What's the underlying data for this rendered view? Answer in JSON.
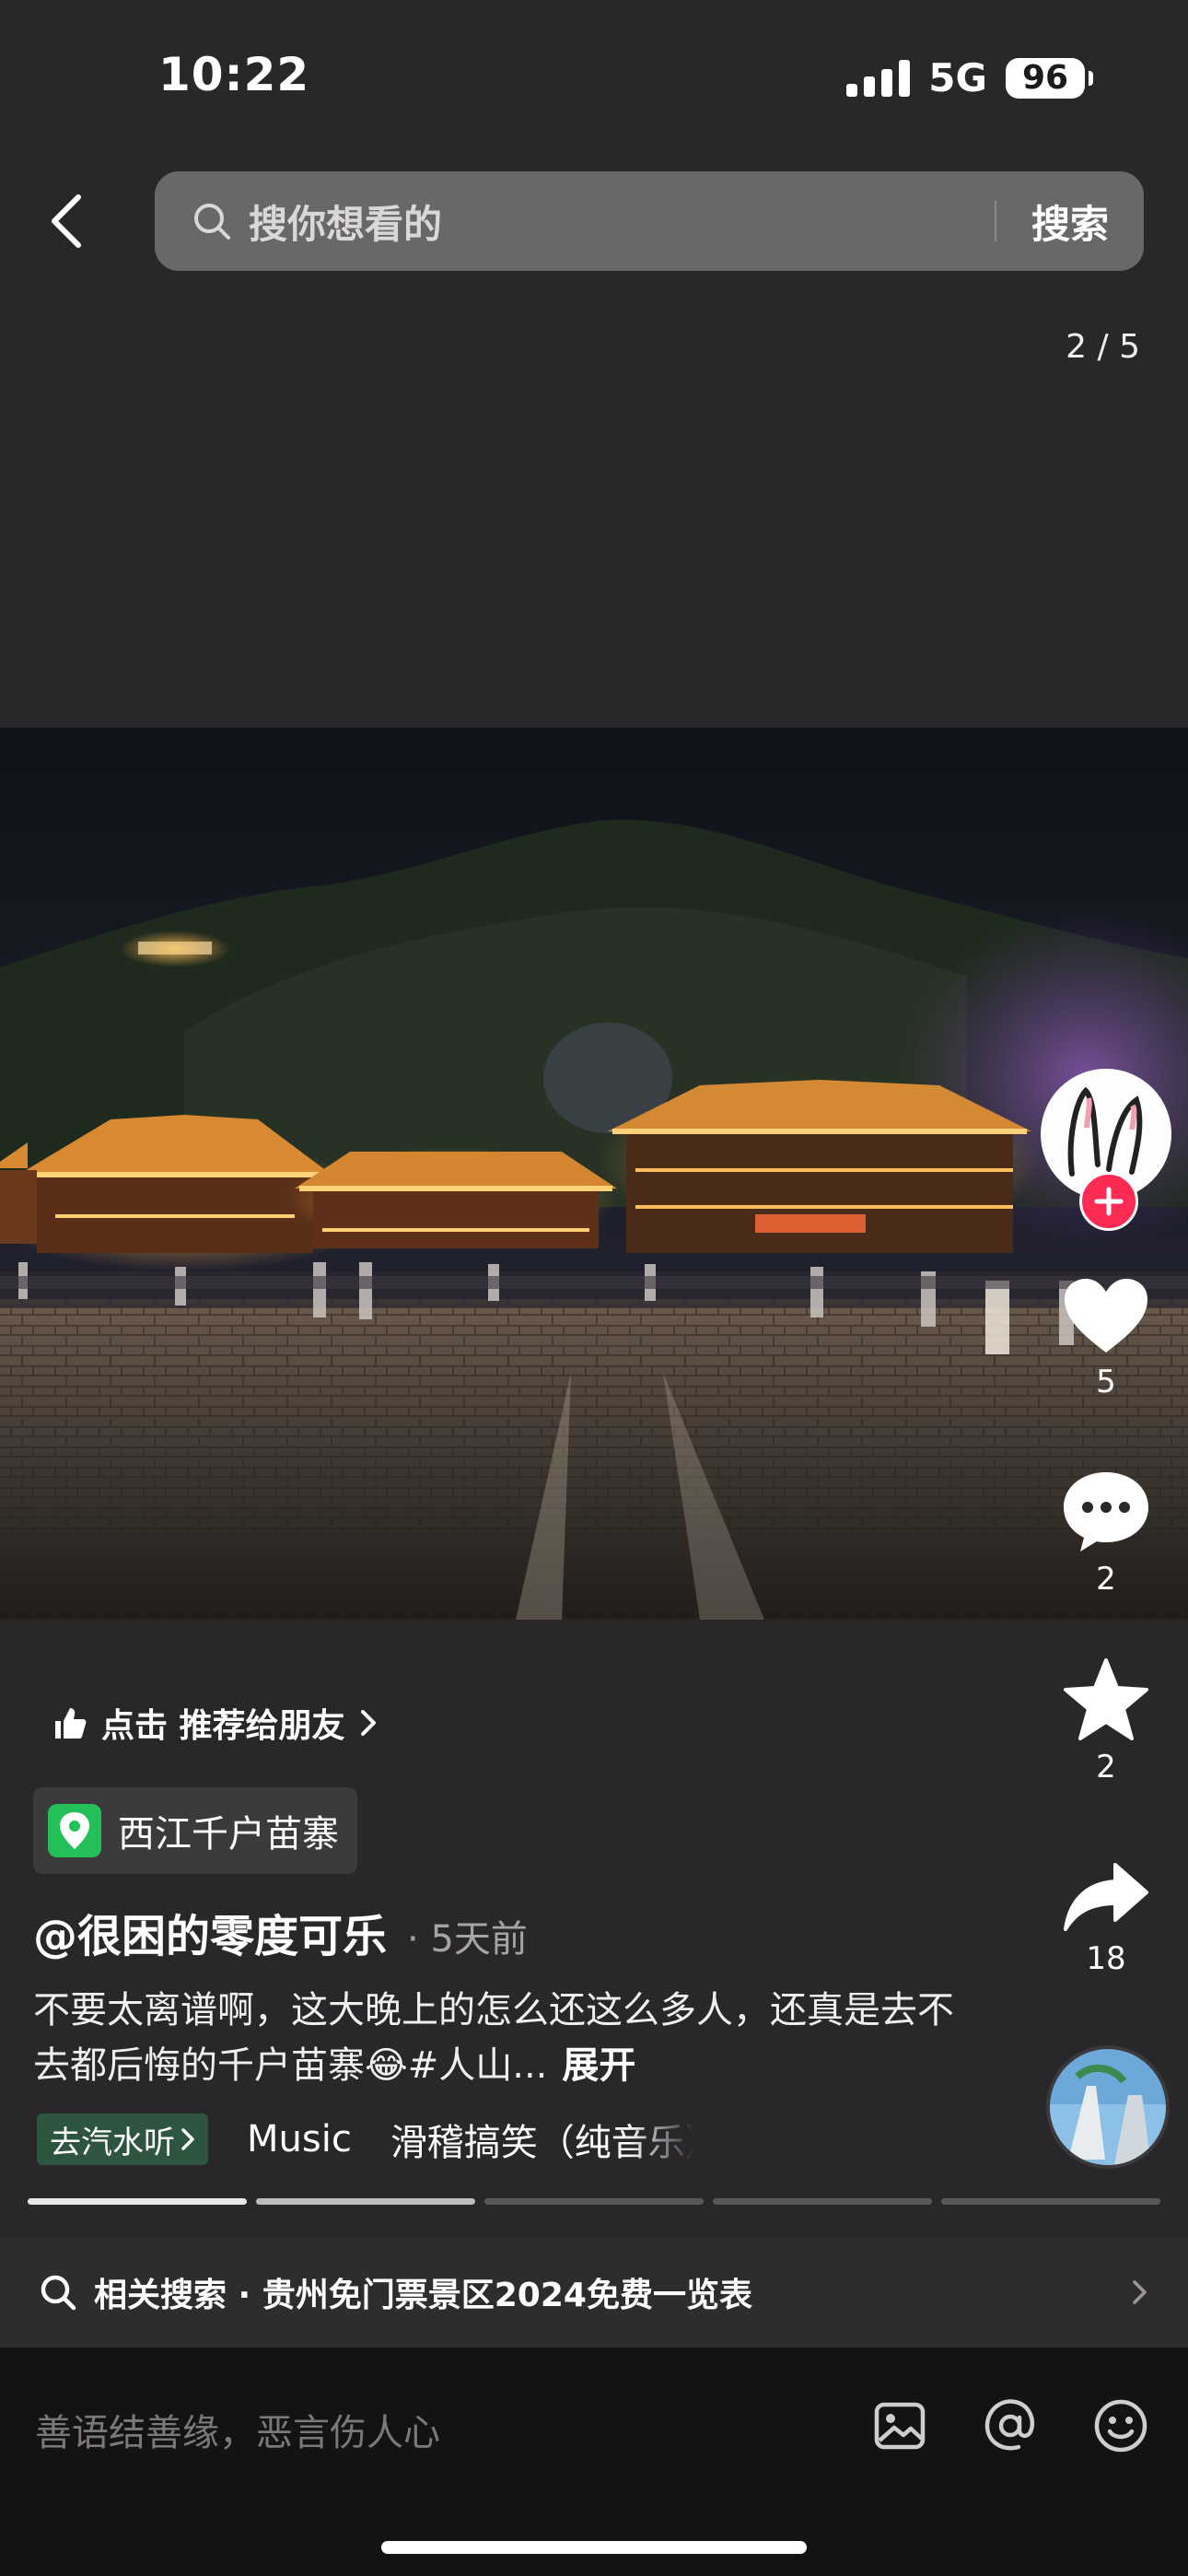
{
  "status_bar": {
    "time": "10:22",
    "network": "5G",
    "battery": "96"
  },
  "header": {
    "search_placeholder": "搜你想看的",
    "search_button": "搜索",
    "page_counter": "2 / 5"
  },
  "actions": {
    "likes": "5",
    "comments": "2",
    "favorites": "2",
    "shares": "18"
  },
  "post": {
    "recommend_text": "点击 推荐给朋友",
    "location": "西江千户苗寨",
    "author": "@很困的零度可乐",
    "time_ago": "· 5天前",
    "caption": "不要太离谱啊，这大晚上的怎么还这么多人，还真是去不去都后悔的千户苗寨😂#人山...",
    "expand": "展开"
  },
  "music": {
    "chip": "去汽水听",
    "label": "Music",
    "title": "滑稽搞笑（纯音乐）"
  },
  "progress": {
    "total": 5,
    "current": 2
  },
  "related_search": {
    "text": "相关搜索 · 贵州免门票景区2024免费一览表"
  },
  "comment_bar": {
    "placeholder": "善语结善缘，恶言伤人心"
  },
  "colors": {
    "background": "#2a272b",
    "follow": "#fe2c55",
    "location_icon": "#23c05a",
    "music_chip": "#2e5540"
  }
}
